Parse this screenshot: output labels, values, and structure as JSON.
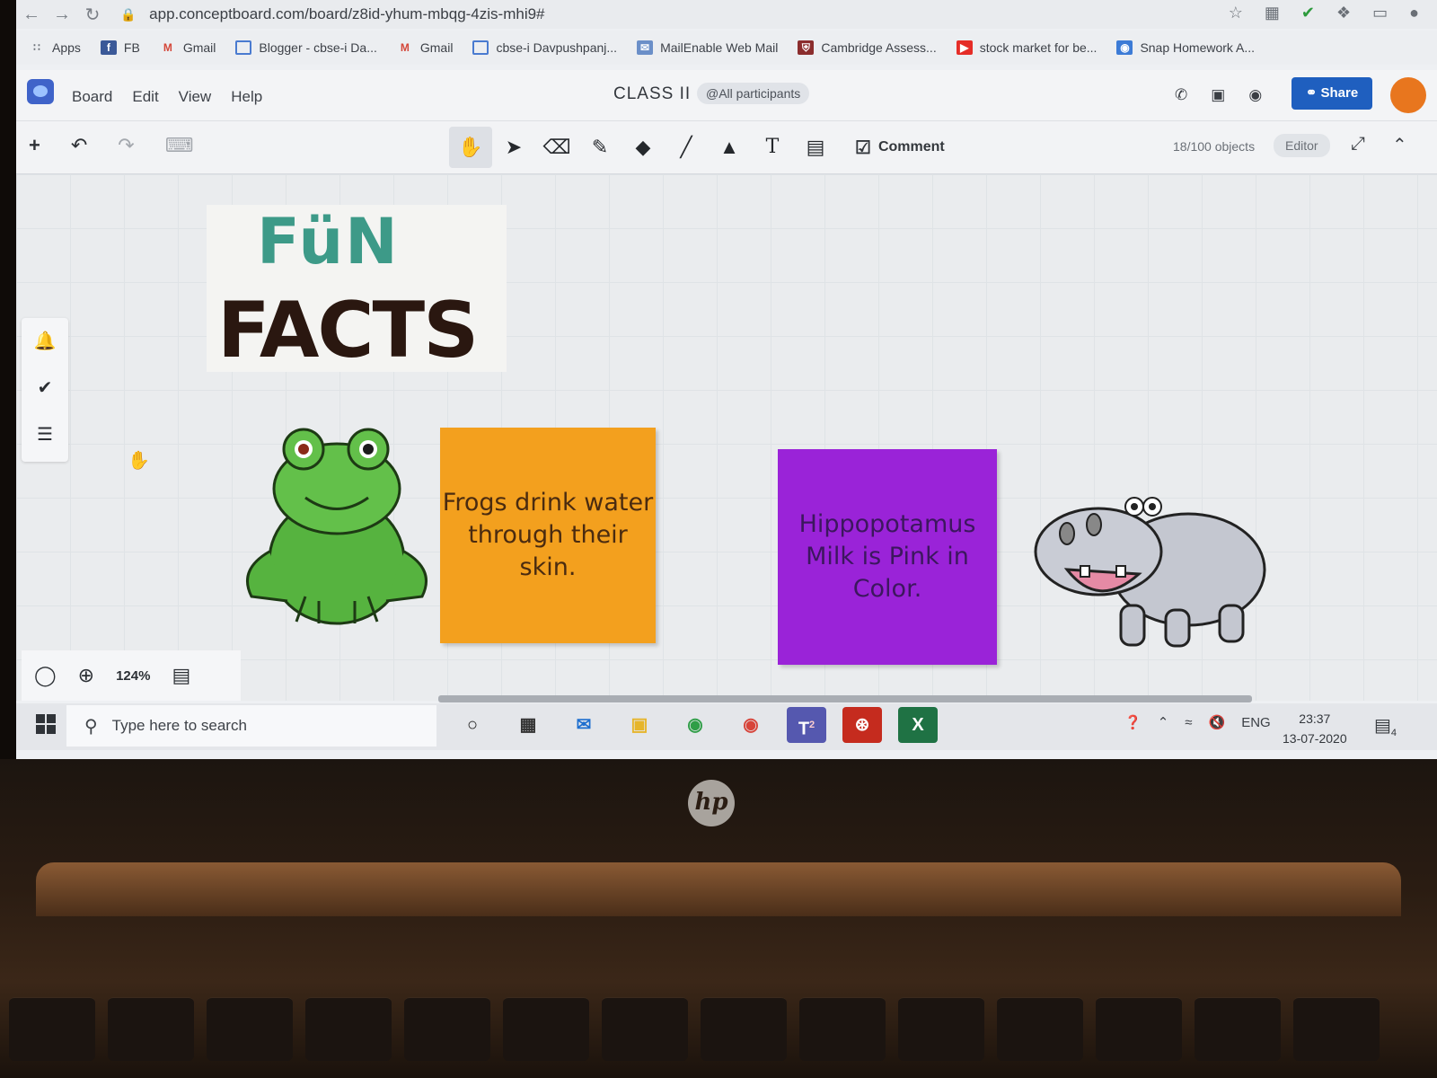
{
  "browser": {
    "url": "app.conceptboard.com/board/z8id-yhum-mbqg-4zis-mhi9#",
    "bookmarks": [
      {
        "label": "Apps",
        "icon": "apps-grid-icon",
        "color": "#6b7077"
      },
      {
        "label": "FB",
        "icon": "facebook-icon",
        "color": "#3b5998"
      },
      {
        "label": "Gmail",
        "icon": "gmail-icon",
        "color": "#d44638"
      },
      {
        "label": "Blogger - cbse-i Da...",
        "icon": "blogger-icon",
        "color": "#4a7bd0"
      },
      {
        "label": "Gmail",
        "icon": "gmail-icon",
        "color": "#d44638"
      },
      {
        "label": "cbse-i Davpushpanj...",
        "icon": "blogger-icon",
        "color": "#4a7bd0"
      },
      {
        "label": "MailEnable Web Mail",
        "icon": "mail-icon",
        "color": "#6b8fc8"
      },
      {
        "label": "Cambridge Assess...",
        "icon": "shield-icon",
        "color": "#8b2d2d"
      },
      {
        "label": "stock market for be...",
        "icon": "youtube-icon",
        "color": "#e52d27"
      },
      {
        "label": "Snap Homework A...",
        "icon": "camera-icon",
        "color": "#3c7bd6"
      }
    ]
  },
  "app": {
    "menu": [
      "Board",
      "Edit",
      "View",
      "Help"
    ],
    "board_title": "CLASS II",
    "participants_badge": "@All participants",
    "share_label": "Share",
    "comment_label": "Comment",
    "object_count": "18/100 objects",
    "role_badge": "Editor",
    "zoom_level": "124%"
  },
  "board": {
    "title_fun": "FüN",
    "title_facts": "FACTS",
    "note_frog": "Frogs drink water through their skin.",
    "note_hippo": "Hippopotamus Milk is Pink in Color.",
    "note_colors": {
      "orange": "#f3a01e",
      "purple": "#9a23d8"
    }
  },
  "taskbar": {
    "search_placeholder": "Type here to search",
    "language": "ENG",
    "time": "23:37",
    "date": "13-07-2020",
    "teams_badge": "2",
    "notification_count": "4"
  }
}
